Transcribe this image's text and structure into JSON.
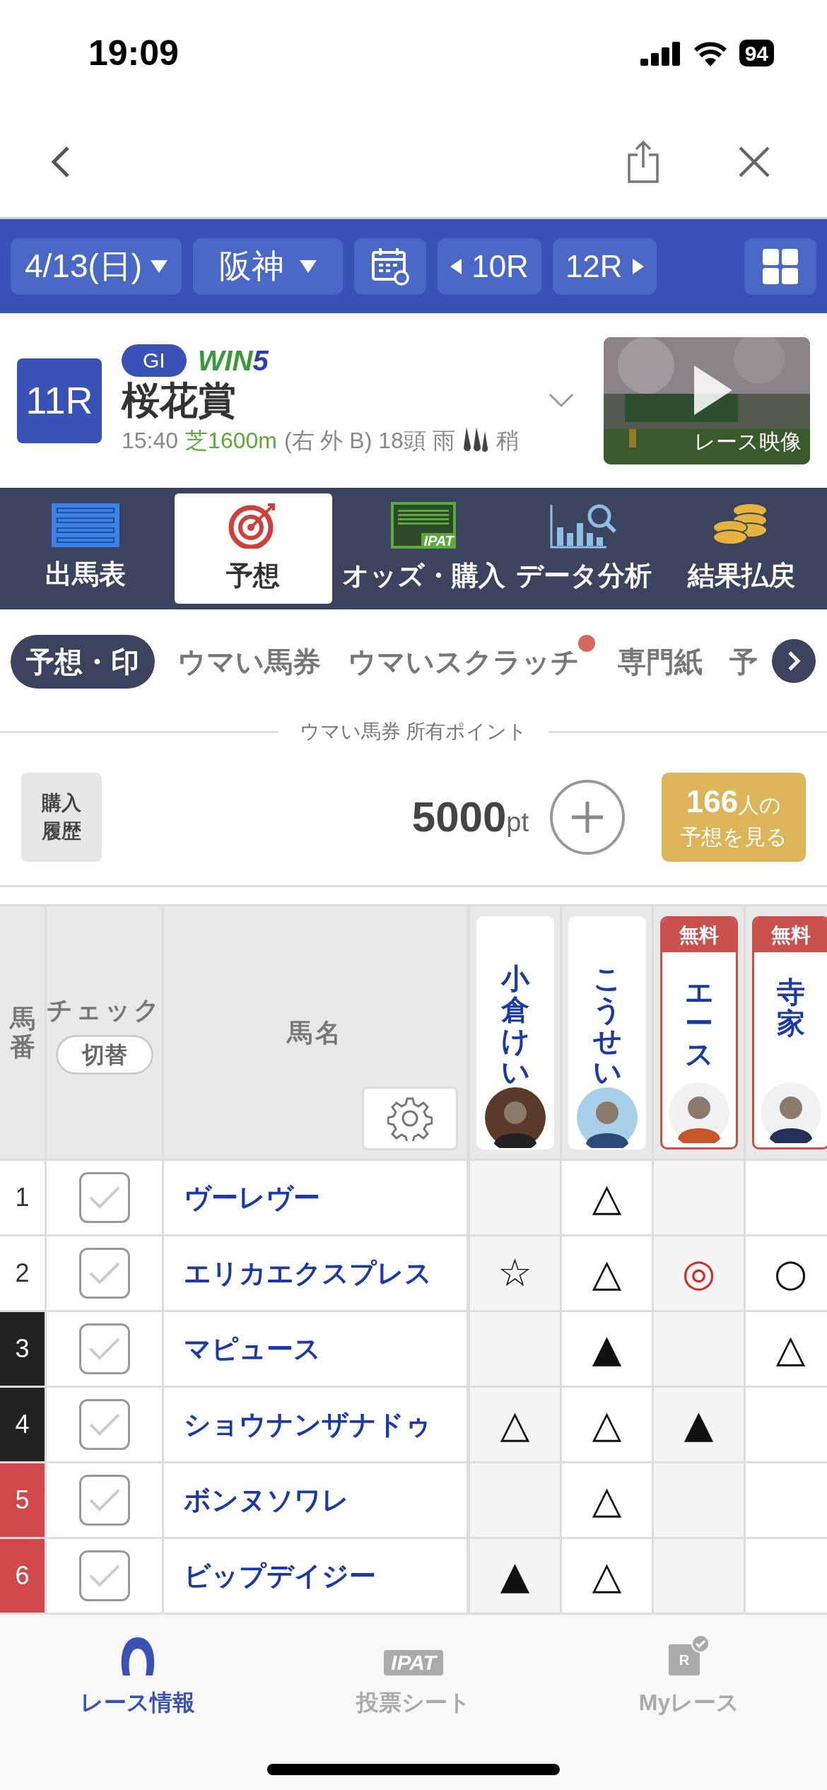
{
  "status_bar": {
    "time": "19:09",
    "battery": "94"
  },
  "race_nav": {
    "date": "4/13(日)",
    "venue": "阪神",
    "prev": "10R",
    "next": "12R"
  },
  "race": {
    "number": "11R",
    "grade": "GI",
    "win5": [
      "WIN",
      "5"
    ],
    "title": "桜花賞",
    "time": "15:40",
    "course": "芝1600m",
    "details": "(右 外 B) 18頭 雨",
    "going": "稍",
    "video_label": "レース映像"
  },
  "main_tabs": [
    {
      "label": "出馬表",
      "selected": false
    },
    {
      "label": "予想",
      "selected": true
    },
    {
      "label": "オッズ・購入",
      "badge": "IPAT",
      "selected": false
    },
    {
      "label": "データ分析",
      "selected": false
    },
    {
      "label": "結果払戻",
      "selected": false
    }
  ],
  "sub_tabs": [
    {
      "label": "予想・印",
      "selected": true,
      "dot": false
    },
    {
      "label": "ウマい馬券",
      "selected": false,
      "dot": false
    },
    {
      "label": "ウマいスクラッチ",
      "selected": false,
      "dot": true
    },
    {
      "label": "専門紙",
      "selected": false,
      "dot": false
    },
    {
      "label": "予",
      "selected": false,
      "dot": false
    }
  ],
  "points": {
    "caption": "ウマい馬券 所有ポイント",
    "history_button": "購入履歴",
    "value": "5000",
    "unit": "pt",
    "predictions_count": "166",
    "predictions_unit": "人の",
    "predictions_label": "予想を見る"
  },
  "table": {
    "columns": {
      "number": "馬番",
      "check": "チェック",
      "toggle": "切替",
      "name": "馬名"
    },
    "predictors": [
      {
        "name": "小倉けい",
        "free": false
      },
      {
        "name": "こうせい",
        "free": false
      },
      {
        "name": "エース",
        "free": true,
        "free_label": "無料"
      },
      {
        "name": "寺家",
        "free": true,
        "free_label": "無料"
      }
    ],
    "rows": [
      {
        "number": "1",
        "color": "#ffffff",
        "checked": false,
        "name": "ヴーレヴー",
        "marks": {
          "predictor_2": {
            "mark": "△"
          }
        }
      },
      {
        "number": "2",
        "color": "#ffffff",
        "checked": false,
        "name": "エリカエクスプレス",
        "marks": {
          "predictor_1": {
            "mark": "☆"
          },
          "predictor_2": {
            "mark": "△"
          },
          "predictor_3": {
            "mark": "◎",
            "color": "#d42b2b"
          },
          "predictor_4": {
            "mark": "○"
          }
        }
      },
      {
        "number": "3",
        "color": "#222222",
        "checked": false,
        "name": "マピュース",
        "marks": {
          "predictor_2": {
            "mark": "▲"
          },
          "predictor_4": {
            "mark": "△"
          }
        }
      },
      {
        "number": "4",
        "color": "#222222",
        "checked": false,
        "name": "ショウナンザナドゥ",
        "marks": {
          "predictor_1": {
            "mark": "△"
          },
          "predictor_2": {
            "mark": "△"
          },
          "predictor_3": {
            "mark": "▲"
          }
        }
      },
      {
        "number": "5",
        "color": "#d0484a",
        "checked": false,
        "name": "ボンヌソワレ",
        "marks": {
          "predictor_2": {
            "mark": "△"
          }
        }
      },
      {
        "number": "6",
        "color": "#d0484a",
        "checked": false,
        "name": "ビップデイジー",
        "marks": {
          "predictor_1": {
            "mark": "▲"
          },
          "predictor_2": {
            "mark": "△"
          }
        }
      }
    ]
  },
  "bottom_nav": [
    {
      "label": "レース情報",
      "selected": true
    },
    {
      "label": "投票シート",
      "badge": "IPAT",
      "selected": false
    },
    {
      "label": "Myレース",
      "badge": "R",
      "selected": false
    }
  ]
}
